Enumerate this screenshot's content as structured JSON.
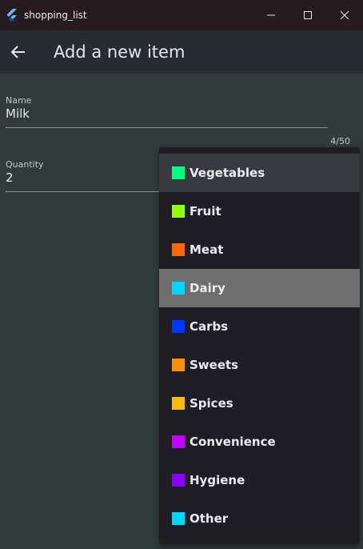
{
  "window": {
    "title": "shopping_list",
    "icons": [
      "flutter-logo",
      "minimize-icon",
      "maximize-icon",
      "close-icon"
    ]
  },
  "appbar": {
    "title": "Add a new item",
    "back_icon": "arrow-left-icon"
  },
  "form": {
    "name": {
      "label": "Name",
      "value": "Milk",
      "counter": "4/50"
    },
    "quantity": {
      "label": "Quantity",
      "value": "2"
    }
  },
  "dropdown": {
    "items": [
      {
        "label": "Vegetables",
        "color": "#00ff80",
        "state": "hover"
      },
      {
        "label": "Fruit",
        "color": "#91ff00",
        "state": ""
      },
      {
        "label": "Meat",
        "color": "#ff6600",
        "state": ""
      },
      {
        "label": "Dairy",
        "color": "#00d7ff",
        "state": "selected"
      },
      {
        "label": "Carbs",
        "color": "#0033ff",
        "state": ""
      },
      {
        "label": "Sweets",
        "color": "#ff9100",
        "state": ""
      },
      {
        "label": "Spices",
        "color": "#ffbb00",
        "state": ""
      },
      {
        "label": "Convenience",
        "color": "#c400ff",
        "state": ""
      },
      {
        "label": "Hygiene",
        "color": "#8800ff",
        "state": ""
      },
      {
        "label": "Other",
        "color": "#00d7ff",
        "state": ""
      }
    ]
  }
}
